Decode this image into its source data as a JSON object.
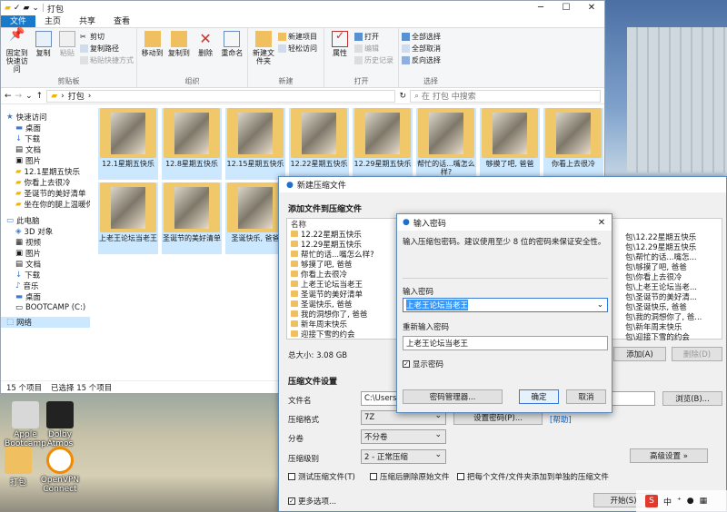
{
  "explorer": {
    "title": "打包",
    "tabs": [
      "文件",
      "主页",
      "共享",
      "查看"
    ],
    "ribbon": {
      "clipboard": {
        "label": "剪贴板",
        "pin": "固定到快速访问",
        "copy": "复制",
        "paste": "粘贴",
        "cut": "剪切",
        "copy_path": "复制路径",
        "paste_shortcut": "粘贴快捷方式"
      },
      "organize": {
        "label": "组织",
        "move_to": "移动到",
        "copy_to": "复制到",
        "delete": "删除",
        "rename": "重命名"
      },
      "new": {
        "label": "新建",
        "new_folder": "新建文件夹",
        "new_item": "新建项目",
        "easy_access": "轻松访问"
      },
      "open": {
        "label": "打开",
        "properties": "属性",
        "open": "打开",
        "edit": "编辑",
        "history": "历史记录"
      },
      "select": {
        "label": "选择",
        "select_all": "全部选择",
        "select_none": "全部取消",
        "invert": "反向选择"
      }
    },
    "address": "打包",
    "search_placeholder": "在 打包 中搜索",
    "nav": [
      {
        "label": "快速访问",
        "icon": "star-icon"
      },
      {
        "label": "桌面",
        "icon": "desktop-icon"
      },
      {
        "label": "下载",
        "icon": "download-icon"
      },
      {
        "label": "文档",
        "icon": "document-icon"
      },
      {
        "label": "图片",
        "icon": "picture-icon"
      },
      {
        "label": "12.1星期五快乐",
        "icon": "folder-icon"
      },
      {
        "label": "你看上去很冷",
        "icon": "folder-icon"
      },
      {
        "label": "圣诞节的美好清单",
        "icon": "folder-icon"
      },
      {
        "label": "坐在你的腿上温暖你",
        "icon": "folder-icon"
      },
      {
        "label": "此电脑",
        "icon": "pc-icon"
      },
      {
        "label": "3D 对象",
        "icon": "3d-icon"
      },
      {
        "label": "视频",
        "icon": "video-icon"
      },
      {
        "label": "图片",
        "icon": "picture-icon"
      },
      {
        "label": "文档",
        "icon": "document-icon"
      },
      {
        "label": "下载",
        "icon": "download-icon"
      },
      {
        "label": "音乐",
        "icon": "music-icon"
      },
      {
        "label": "桌面",
        "icon": "desktop-icon"
      },
      {
        "label": "BOOTCAMP (C:)",
        "icon": "drive-icon"
      },
      {
        "label": "网络",
        "icon": "network-icon"
      }
    ],
    "folders": [
      "12.1星期五快乐",
      "12.8星期五快乐",
      "12.15星期五快乐",
      "12.22星期五快乐",
      "12.29星期五快乐",
      "帮忙的话...嘴怎么样?",
      "够摸了吧, 爸爸",
      "你看上去很冷",
      "上老王论坛当老王",
      "圣诞节的美好清单",
      "圣诞快乐, 爸爸"
    ],
    "status_count": "15 个项目",
    "status_selected": "已选择 15 个项目"
  },
  "desktop_icons": [
    {
      "label": "Apple Bootcamp"
    },
    {
      "label": "Dolby Atmos"
    },
    {
      "label": "打包"
    },
    {
      "label": "OpenVPN Connect"
    }
  ],
  "archive": {
    "title": "新建压缩文件",
    "add_section": "添加文件到压缩文件",
    "list_header": "名称",
    "files_left": [
      "12.22星期五快乐",
      "12.29星期五快乐",
      "帮忙的话...嘴怎么样?",
      "够摸了吧, 爸爸",
      "你看上去很冷",
      "上老王论坛当老王",
      "圣诞节的美好清单",
      "圣诞快乐, 爸爸",
      "我的洞想你了, 爸爸",
      "新年周末快乐",
      "迎接下雪的约会"
    ],
    "files_right": [
      "包\\12.22星期五快乐",
      "包\\12.29星期五快乐",
      "包\\帮忙的话...嘴怎...",
      "包\\够摸了吧, 爸爸",
      "包\\你看上去很冷",
      "包\\上老王论坛当老...",
      "包\\圣诞节的美好清...",
      "包\\圣诞快乐, 爸爸",
      "包\\我的洞想你了, 爸...",
      "包\\新年周末快乐",
      "包\\迎接下雪的约会"
    ],
    "total_size": "总大小: 3.08 GB",
    "add_btn": "添加(A)",
    "delete_btn": "删除(D)",
    "settings_section": "压缩文件设置",
    "filename_label": "文件名",
    "filename_value": "C:\\Users\\",
    "browse_btn": "浏览(B)...",
    "format_label": "压缩格式",
    "format_value": "7Z",
    "set_password_btn": "设置密码(P)...",
    "help_link": "[帮助]",
    "split_label": "分卷",
    "split_value": "不分卷",
    "level_label": "压缩级别",
    "level_value": "2 - 正常压缩",
    "advanced_btn": "高级设置 »",
    "opt_test": "测试压缩文件(T)",
    "opt_delete": "压缩后删除原始文件",
    "opt_each": "把每个文件/文件夹添加到单独的压缩文件",
    "more_options": "更多选项...",
    "start_btn": "开始(S)"
  },
  "password_dialog": {
    "title": "输入密码",
    "hint": "输入压缩包密码。建议使用至少 8 位的密码来保证安全性。",
    "pwd_label": "输入密码",
    "pwd_value": "上老王论坛当老王",
    "confirm_label": "重新输入密码",
    "confirm_value": "上老王论坛当老王",
    "show_password": "显示密码",
    "manager_btn": "密码管理器...",
    "ok_btn": "确定",
    "cancel_btn": "取消"
  },
  "taskbar": {
    "ime": "中"
  }
}
